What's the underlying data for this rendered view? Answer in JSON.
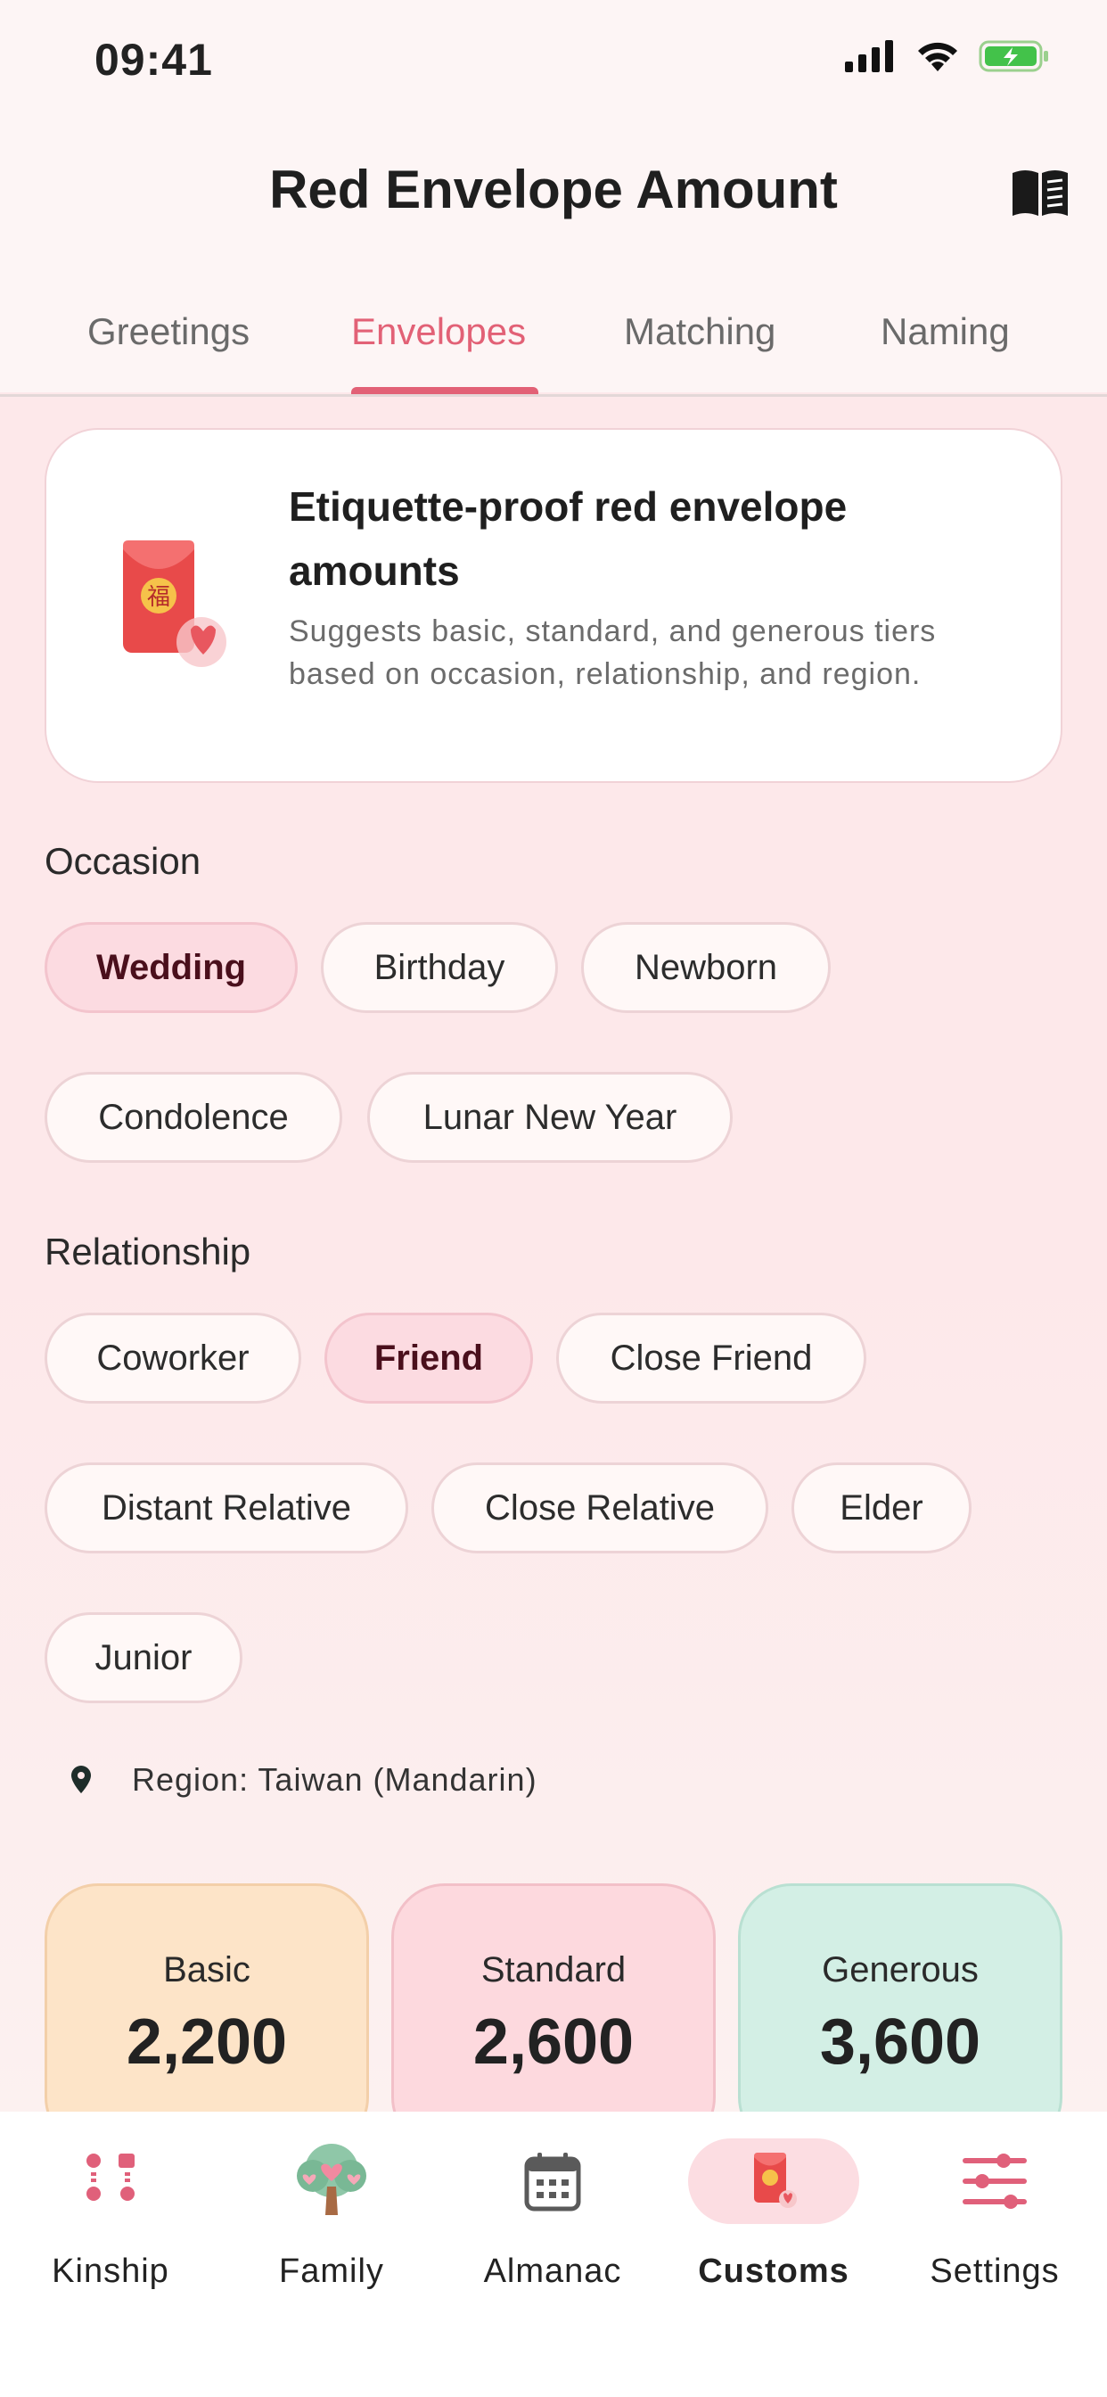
{
  "status": {
    "time": "09:41"
  },
  "header": {
    "title": "Red Envelope Amount"
  },
  "tabs": [
    {
      "label": "Greetings"
    },
    {
      "label": "Envelopes",
      "active": true
    },
    {
      "label": "Matching"
    },
    {
      "label": "Naming"
    }
  ],
  "intro": {
    "title": "Etiquette-proof red envelope amounts",
    "subtitle": "Suggests basic, standard, and generous tiers based on occasion, relationship, and region.",
    "icon_char": "福"
  },
  "occasion": {
    "label": "Occasion",
    "options": [
      "Wedding",
      "Birthday",
      "Newborn",
      "Condolence",
      "Lunar New Year"
    ],
    "selected": "Wedding"
  },
  "relationship": {
    "label": "Relationship",
    "options": [
      "Coworker",
      "Friend",
      "Close Friend",
      "Distant Relative",
      "Close Relative",
      "Elder",
      "Junior"
    ],
    "selected": "Friend"
  },
  "region": {
    "text": "Region: Taiwan (Mandarin)"
  },
  "tiers": [
    {
      "label": "Basic",
      "amount": "2,200"
    },
    {
      "label": "Standard",
      "amount": "2,600"
    },
    {
      "label": "Generous",
      "amount": "3,600"
    }
  ],
  "nav": [
    {
      "label": "Kinship"
    },
    {
      "label": "Family"
    },
    {
      "label": "Almanac"
    },
    {
      "label": "Customs",
      "active": true
    },
    {
      "label": "Settings"
    }
  ],
  "colors": {
    "accent": "#e26176",
    "selected_chip": "#fcdbe1",
    "basic": "#fde4c8",
    "standard": "#fdd9de",
    "generous": "#d3efe5"
  }
}
